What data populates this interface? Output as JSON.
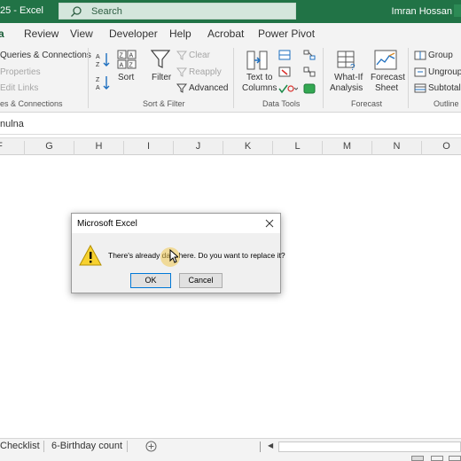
{
  "titlebar": {
    "file_fragment": "25  -  Excel",
    "search_placeholder": "Search",
    "user": "Imran Hossan",
    "bg_color": "#217346"
  },
  "tabs": [
    {
      "label": "a",
      "active": true
    },
    {
      "label": "Review"
    },
    {
      "label": "View"
    },
    {
      "label": "Developer"
    },
    {
      "label": "Help"
    },
    {
      "label": "Acrobat"
    },
    {
      "label": "Power Pivot"
    }
  ],
  "ribbon": {
    "queries": {
      "items": [
        "Queries & Connections",
        "Properties",
        "Edit Links"
      ],
      "group_label": "es & Connections"
    },
    "sort_filter": {
      "sort_label": "Sort",
      "filter_label": "Filter",
      "clear_label": "Clear",
      "reapply_label": "Reapply",
      "advanced_label": "Advanced",
      "group_label": "Sort & Filter"
    },
    "data_tools": {
      "text_to_columns_line1": "Text to",
      "text_to_columns_line2": "Columns",
      "group_label": "Data Tools"
    },
    "forecast": {
      "whatif_line1": "What-If",
      "whatif_line2": "Analysis",
      "sheet_line1": "Forecast",
      "sheet_line2": "Sheet",
      "group_label": "Forecast"
    },
    "outline": {
      "group_item": "Group",
      "ungroup_item": "Ungroup",
      "subtotal_item": "Subtotal",
      "group_label": "Outline"
    }
  },
  "formula_bar": {
    "cell_ref": "nulna"
  },
  "columns": [
    "F",
    "G",
    "H",
    "I",
    "J",
    "K",
    "L",
    "M",
    "N",
    "O"
  ],
  "sheets": {
    "tab1": "Checklist",
    "tab2": "6-Birthday count"
  },
  "dialog": {
    "title": "Microsoft Excel",
    "message": "There's already data here. Do you want to replace it?",
    "ok_label": "OK",
    "cancel_label": "Cancel"
  }
}
